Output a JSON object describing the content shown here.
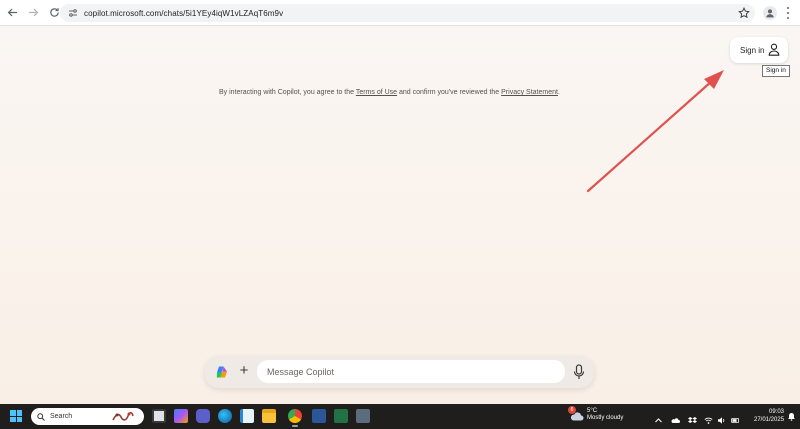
{
  "browser": {
    "url": "copilot.microsoft.com/chats/5i1YEy4iqW1vLZAqT6m9v"
  },
  "header": {
    "signin_label": "Sign in",
    "tooltip": "Sign in"
  },
  "terms": {
    "prefix": "By interacting with Copilot, you agree to the ",
    "terms_link": "Terms of Use",
    "middle": " and confirm you've reviewed the ",
    "privacy_link": "Privacy Statement",
    "suffix": "."
  },
  "composer": {
    "placeholder": "Message Copilot"
  },
  "taskbar": {
    "search_placeholder": "Search",
    "weather": {
      "badge": "6",
      "temperature": "5°C",
      "condition": "Mostly cloudy"
    },
    "clock": {
      "time": "09:03",
      "date": "27/01/2025"
    }
  },
  "colors": {
    "annotation_arrow": "#e0524f",
    "taskbar": "#1f1e1d",
    "windows_accent": "#4cc2ff"
  },
  "icons": {
    "back": "arrow-left-icon",
    "forward": "arrow-right-icon",
    "reload": "reload-icon",
    "site_settings": "tune-icon",
    "bookmark": "star-icon",
    "profile": "person-icon",
    "menu": "kebab-menu-icon",
    "signin": "user-icon",
    "add": "plus-icon",
    "voice": "microphone-icon"
  }
}
